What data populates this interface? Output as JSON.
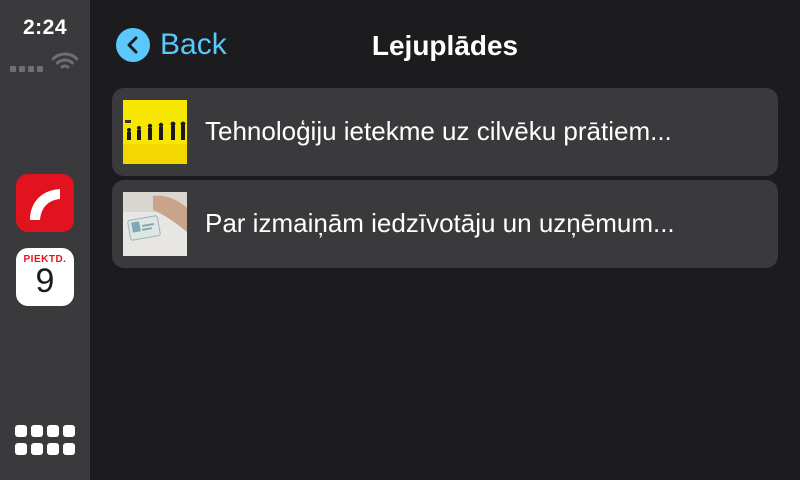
{
  "status_bar": {
    "time": "2:24"
  },
  "sidebar": {
    "apps": [
      {
        "name": "red-app",
        "icon": "red-swoosh-icon"
      },
      {
        "name": "calendar",
        "icon": "calendar-icon",
        "day": "PIEKTD.",
        "date": "9"
      }
    ],
    "app_grid_icon": "app-grid-icon"
  },
  "nav": {
    "back_label": "Back",
    "title": "Lejuplādes"
  },
  "list": {
    "items": [
      {
        "label": "Tehnoloģiju ietekme uz cilvēku prātiem...",
        "thumbnail": "evolution-thumbnail"
      },
      {
        "label": "Par izmaiņām iedzīvotāju un uzņēmum...",
        "thumbnail": "id-card-thumbnail"
      }
    ]
  },
  "colors": {
    "accent": "#5ac8fa",
    "background": "#1c1c1e",
    "sidebar": "#3a3a3c",
    "row": "#3a3a3c",
    "brand_red": "#e3121f"
  }
}
